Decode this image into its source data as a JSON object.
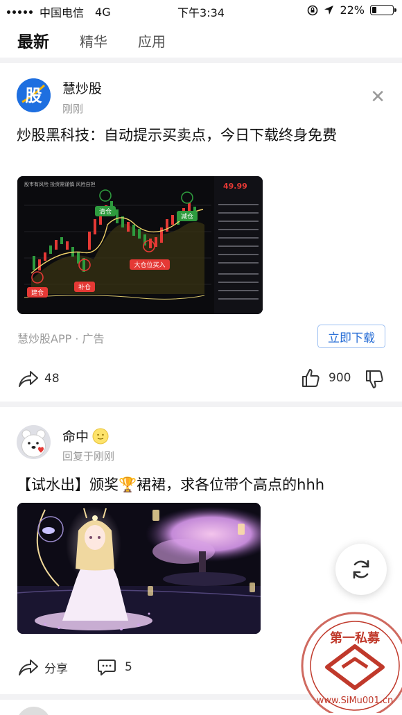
{
  "status_bar": {
    "carrier": "中国电信",
    "network": "4G",
    "time": "下午3:34",
    "battery": "22%",
    "battery_level": 0.22
  },
  "tabs": [
    "最新",
    "精华",
    "应用"
  ],
  "active_tab": 0,
  "posts": [
    {
      "author": "慧炒股",
      "avatar_text": "股",
      "subtitle": "刚刚",
      "text": "炒股黑科技：自动提示买卖点，今日下载终身免费",
      "image_labels": {
        "price": "49.99",
        "tags": [
          "清仓",
          "减仓",
          "大仓位买入",
          "补仓",
          "建仓"
        ],
        "header": "股市有风险 投资需谨慎 风险自担"
      },
      "source": "慧炒股APP · 广告",
      "download_label": "立即下载",
      "share_count": "48",
      "like_count": "900"
    },
    {
      "author": "命中",
      "subtitle": "回复于刚刚",
      "text": "【试水出】颁奖🏆裙裙，求各位带个高点的hhh",
      "share_label": "分享",
      "comment_count": "5"
    }
  ],
  "watermark": {
    "top_text": "第一私募",
    "bottom_text": "www.SiMu001.cn"
  },
  "colors": {
    "accent_blue": "#2a6fd6",
    "up_red": "#e53935",
    "down_green": "#2e9b3e"
  }
}
